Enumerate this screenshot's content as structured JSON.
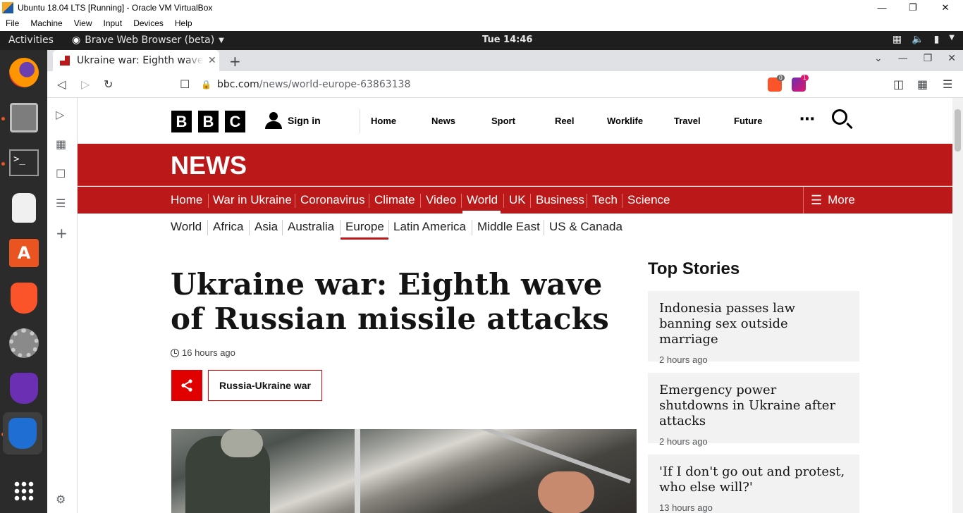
{
  "vbox": {
    "title": "Ubuntu 18.04 LTS [Running] - Oracle VM VirtualBox",
    "menu": [
      "File",
      "Machine",
      "View",
      "Input",
      "Devices",
      "Help"
    ]
  },
  "gnome": {
    "activities": "Activities",
    "app_name": "Brave Web Browser (beta)",
    "clock": "Tue 14:46"
  },
  "browser": {
    "tab_title": "Ukraine war: Eighth wave of Russian missile attacks",
    "url_host": "bbc.com",
    "url_path": "/news/world-europe-63863138",
    "brave_shield_count": "0",
    "rewards_count": "1"
  },
  "bbc": {
    "logo": [
      "B",
      "B",
      "C"
    ],
    "sign_in": "Sign in",
    "top_nav": [
      "Home",
      "News",
      "Sport",
      "Reel",
      "Worklife",
      "Travel",
      "Future"
    ],
    "news_label": "NEWS",
    "news_nav": [
      "Home",
      "War in Ukraine",
      "Coronavirus",
      "Climate",
      "Video",
      "World",
      "UK",
      "Business",
      "Tech",
      "Science"
    ],
    "more": "More",
    "sub_nav": [
      "World",
      "Africa",
      "Asia",
      "Australia",
      "Europe",
      "Latin America",
      "Middle East",
      "US & Canada"
    ]
  },
  "article": {
    "headline": "Ukraine war: Eighth wave of Russian missile attacks",
    "time": "16 hours ago",
    "tag": "Russia-Ukraine war"
  },
  "top_stories": {
    "title": "Top Stories",
    "items": [
      {
        "title": "Indonesia passes law banning sex outside marriage",
        "age": "2 hours ago"
      },
      {
        "title": "Emergency power shutdowns in Ukraine after attacks",
        "age": "2 hours ago"
      },
      {
        "title": "'If I don't go out and protest, who else will?'",
        "age": "13 hours ago"
      }
    ]
  },
  "colors": {
    "bbc_red": "#bb1919",
    "share_red": "#e00000"
  }
}
